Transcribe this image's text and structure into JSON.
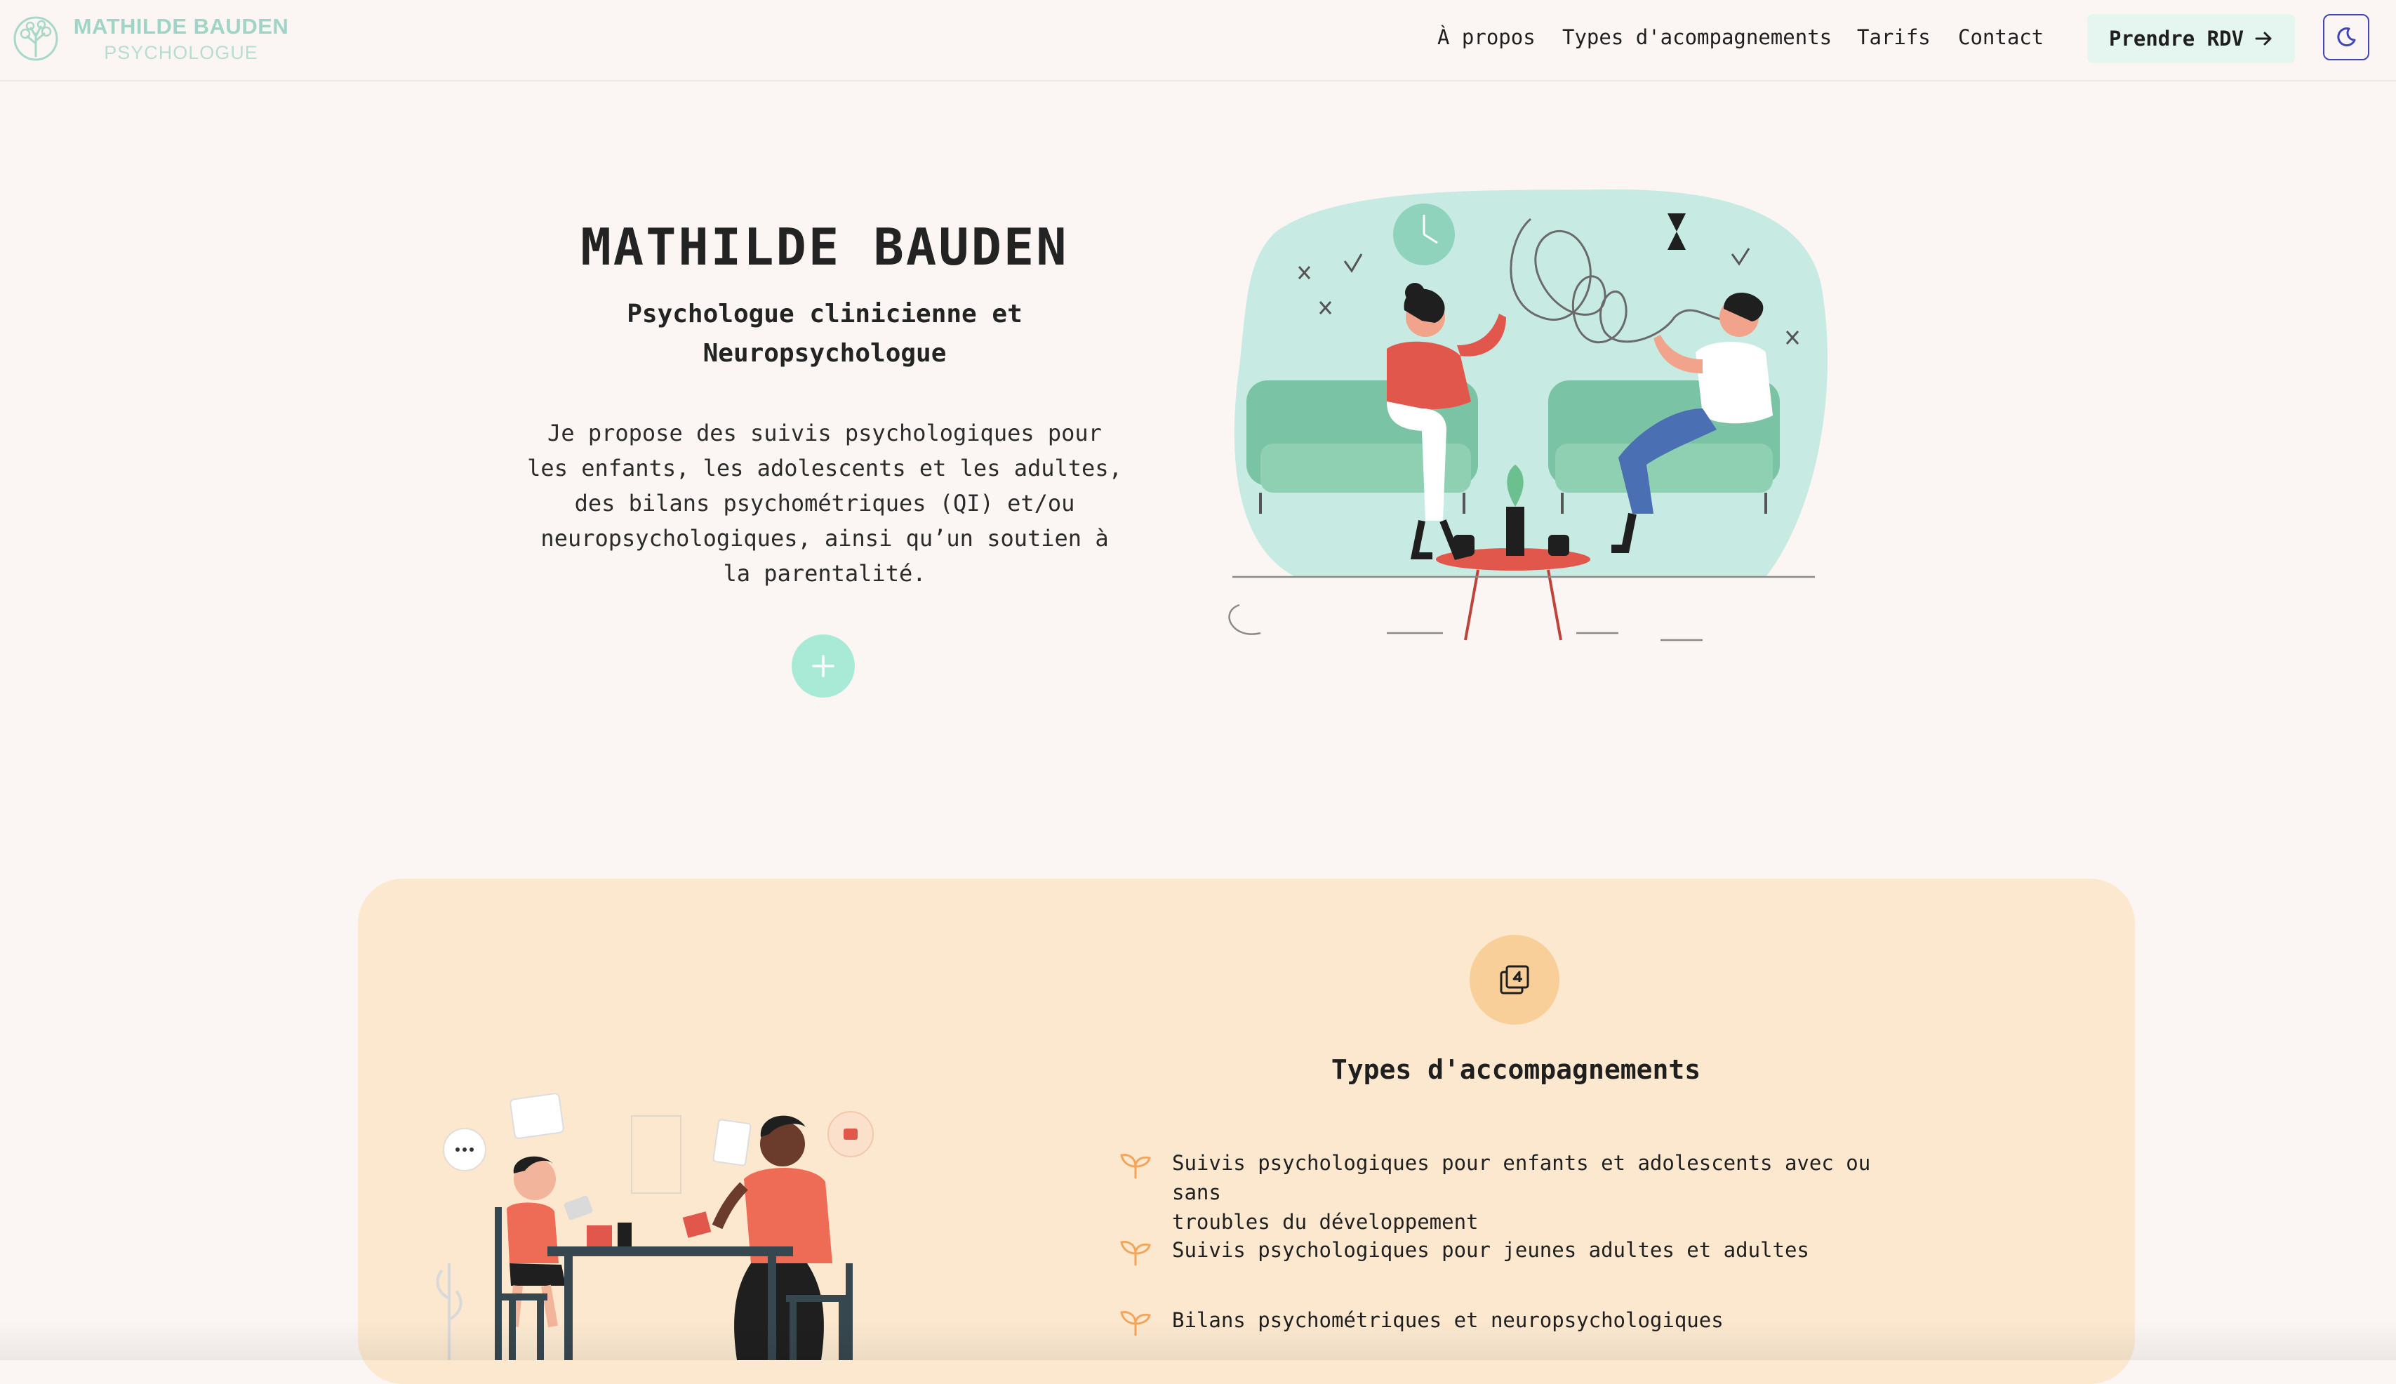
{
  "header": {
    "logo_name": "MATHILDE BAUDEN",
    "logo_sub": "PSYCHOLOGUE",
    "logo_icon": "brain-tree-icon",
    "nav": [
      "À propos",
      "Types d'acompagnements",
      "Tarifs",
      "Contact"
    ],
    "cta_label": "Prendre RDV",
    "cta_icon": "arrow-right-icon",
    "theme_icon": "moon-icon"
  },
  "hero": {
    "title": "MATHILDE BAUDEN",
    "subtitle_line1": "Psychologue clinicienne et",
    "subtitle_line2": "Neuropsychologue",
    "desc": [
      "Je propose des suivis psychologiques pour",
      "les enfants, les adolescents et les adultes,",
      "des bilans psychométriques (QI) et/ou",
      "neuropsychologiques, ainsi qu’un soutien à",
      "la parentalité."
    ],
    "more_icon": "plus-icon"
  },
  "services": {
    "icon": "numbered-layers-icon",
    "title": "Types d'accompagnements",
    "items": [
      {
        "line1": "Suivis psychologiques pour enfants et adolescents avec ou sans",
        "line2": "troubles du développement"
      },
      {
        "line1": "Suivis psychologiques pour jeunes adultes et adultes",
        "line2": ""
      },
      {
        "line1": "Bilans psychométriques et neuropsychologiques",
        "line2": ""
      }
    ],
    "bullet_icon": "sprout-icon"
  },
  "colors": {
    "background": "#fbf6f3",
    "mint": "#a8ead6",
    "card": "#fbe8cf",
    "orange_accent": "#f2a65a",
    "theme_border": "#3f46b8"
  }
}
